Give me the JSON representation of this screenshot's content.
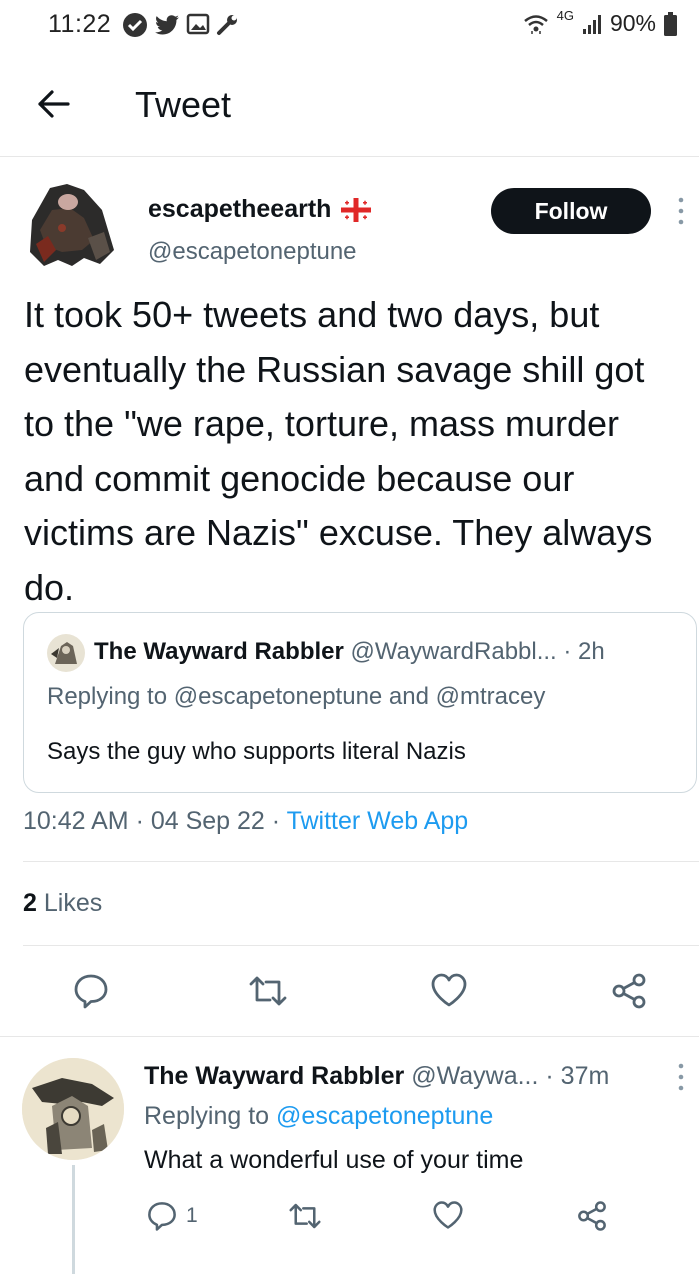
{
  "status_bar": {
    "time": "11:22",
    "network": "4G",
    "battery": "90%"
  },
  "header": {
    "title": "Tweet"
  },
  "tweet": {
    "author_name": "escapetheearth",
    "author_handle": "@escapetoneptune",
    "follow_label": "Follow",
    "text": "It took 50+ tweets and two days, but eventually the Russian savage shill got to the \"we rape, torture, mass murder and commit genocide because our victims are Nazis\" excuse. They always do.",
    "quoted": {
      "name": "The Wayward Rabbler",
      "handle_time": "@WaywardRabbl... · 2h",
      "replying": "Replying to @escapetoneptune and @mtracey",
      "text": "Says the guy who supports literal Nazis"
    },
    "timestamp": "10:42 AM · 04 Sep 22 · ",
    "source": "Twitter Web App",
    "likes_count": "2",
    "likes_label": "Likes"
  },
  "reply": {
    "name": "The Wayward Rabbler",
    "handle_time": "@Waywa... · 37m",
    "replying_prefix": "Replying to ",
    "replying_handle": "@escapetoneptune",
    "text": "What a wonderful use of your time",
    "reply_count": "1"
  },
  "icons": [
    "check-circle-icon",
    "twitter-bird-icon",
    "gallery-icon",
    "wrench-icon",
    "wifi-icon",
    "signal-icon",
    "battery-icon",
    "back-arrow-icon",
    "georgia-flag-icon",
    "more-vertical-icon",
    "reply-icon",
    "retweet-icon",
    "like-icon",
    "share-icon"
  ],
  "colors": {
    "accent": "#1d9bf0",
    "text": "#0f1419",
    "muted": "#536471",
    "border": "#cfd9de"
  }
}
